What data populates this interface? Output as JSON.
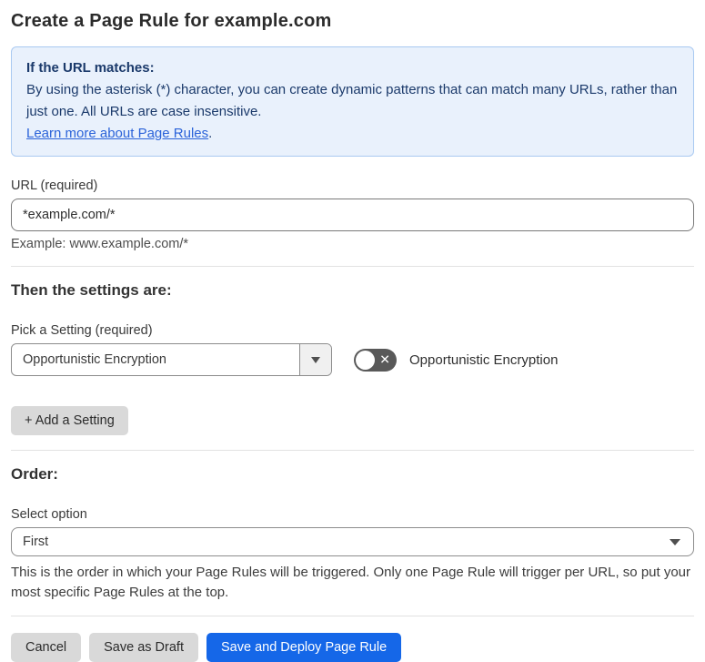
{
  "page": {
    "title": "Create a Page Rule for example.com"
  },
  "info_box": {
    "heading": "If the URL matches:",
    "body": "By using the asterisk (*) character, you can create dynamic patterns that can match many URLs, rather than just one. All URLs are case insensitive.",
    "link": "Learn more about Page Rules",
    "link_suffix": "."
  },
  "url_field": {
    "label": "URL (required)",
    "value": "*example.com/*",
    "example": "Example: www.example.com/*"
  },
  "settings": {
    "heading": "Then the settings are:",
    "picker_label": "Pick a Setting (required)",
    "picker_value": "Opportunistic Encryption",
    "toggle_label": "Opportunistic Encryption",
    "toggle_state": "off",
    "toggle_glyph": "✕",
    "add_button": "+ Add a Setting"
  },
  "order": {
    "heading": "Order:",
    "select_label": "Select option",
    "select_value": "First",
    "help": "This is the order in which your Page Rules will be triggered. Only one Page Rule will trigger per URL, so put your most specific Page Rules at the top."
  },
  "footer": {
    "cancel": "Cancel",
    "save_draft": "Save as Draft",
    "save_deploy": "Save and Deploy Page Rule"
  },
  "colors": {
    "info_background": "#e9f1fc",
    "info_border": "#a9c9f1",
    "info_text": "#1b3a6b",
    "link_blue": "#2b63d9",
    "primary_button_blue": "#1567e8",
    "secondary_button_gray": "#d9d9d9",
    "toggle_off_gray": "#595959"
  }
}
